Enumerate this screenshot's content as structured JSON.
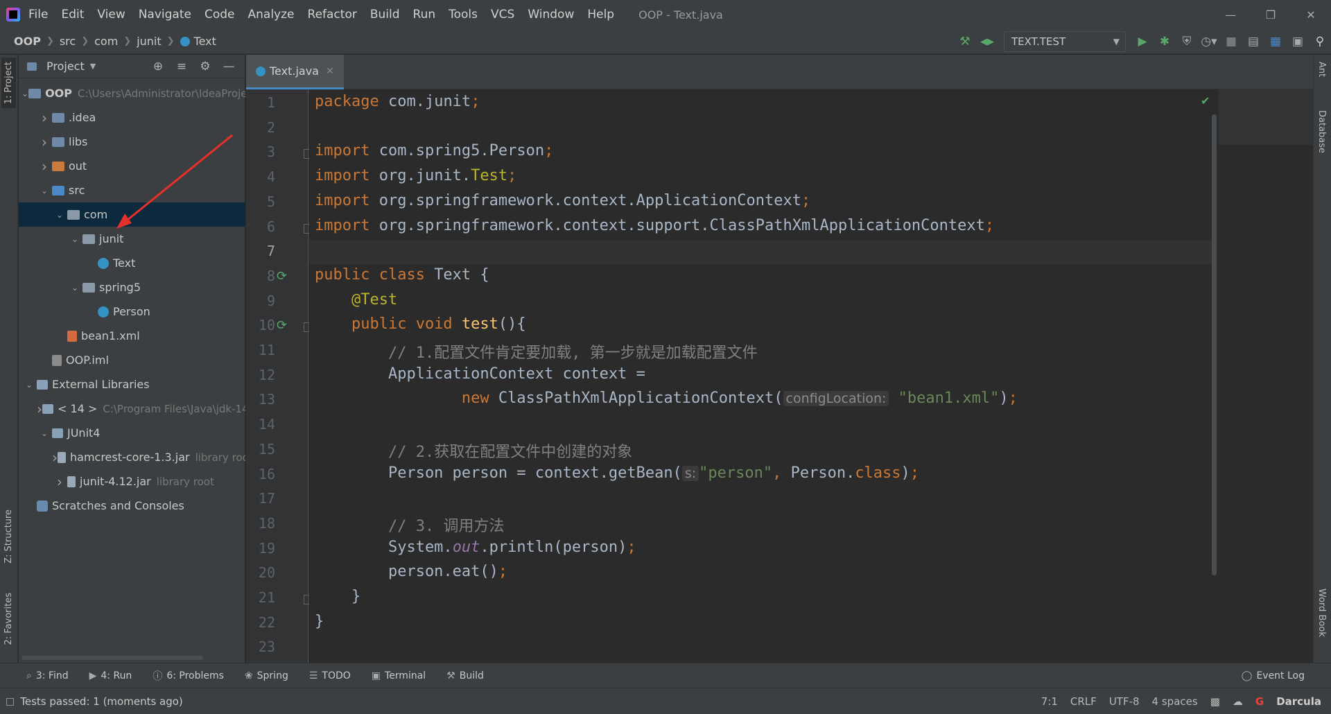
{
  "app": {
    "window_title": "OOP - Text.java",
    "menu": [
      "File",
      "Edit",
      "View",
      "Navigate",
      "Code",
      "Analyze",
      "Refactor",
      "Build",
      "Run",
      "Tools",
      "VCS",
      "Window",
      "Help"
    ]
  },
  "breadcrumbs": [
    "OOP",
    "src",
    "com",
    "junit",
    "Text"
  ],
  "toolbar": {
    "run_config": "TEXT.TEST",
    "icons": [
      "hammer-icon",
      "nav-back-forward-icon",
      "run-icon",
      "debug-icon",
      "coverage-icon",
      "profile-icon",
      "stop-icon",
      "project-structure-icon",
      "translate-icon",
      "terminal-icon",
      "search-icon"
    ]
  },
  "project_panel": {
    "title": "Project",
    "tree": [
      {
        "depth": 0,
        "arrow": "open",
        "icon": "folder",
        "label": "OOP",
        "bold": true,
        "path": "C:\\Users\\Administrator\\IdeaProje"
      },
      {
        "depth": 1,
        "arrow": "closed",
        "icon": "folder",
        "label": ".idea"
      },
      {
        "depth": 1,
        "arrow": "closed",
        "icon": "folder",
        "label": "libs"
      },
      {
        "depth": 1,
        "arrow": "closed",
        "icon": "folder-orange",
        "label": "out"
      },
      {
        "depth": 1,
        "arrow": "open",
        "icon": "folder-blue",
        "label": "src"
      },
      {
        "depth": 2,
        "arrow": "open",
        "icon": "pkg",
        "label": "com",
        "selected": true
      },
      {
        "depth": 3,
        "arrow": "open",
        "icon": "pkg",
        "label": "junit"
      },
      {
        "depth": 4,
        "arrow": "",
        "icon": "cls",
        "label": "Text"
      },
      {
        "depth": 3,
        "arrow": "open",
        "icon": "pkg",
        "label": "spring5"
      },
      {
        "depth": 4,
        "arrow": "",
        "icon": "cls",
        "label": "Person"
      },
      {
        "depth": 2,
        "arrow": "",
        "icon": "xml",
        "label": "bean1.xml"
      },
      {
        "depth": 1,
        "arrow": "",
        "icon": "iml",
        "label": "OOP.iml"
      },
      {
        "depth": 0,
        "arrow": "open",
        "icon": "lib",
        "label": "External Libraries"
      },
      {
        "depth": 1,
        "arrow": "closed",
        "icon": "lib",
        "label": "< 14 >",
        "path": "C:\\Program Files\\Java\\jdk-14"
      },
      {
        "depth": 1,
        "arrow": "open",
        "icon": "lib",
        "label": "JUnit4"
      },
      {
        "depth": 2,
        "arrow": "closed",
        "icon": "jar",
        "label": "hamcrest-core-1.3.jar",
        "path": "library roo"
      },
      {
        "depth": 2,
        "arrow": "closed",
        "icon": "jar",
        "label": "junit-4.12.jar",
        "path": "library root"
      },
      {
        "depth": 0,
        "arrow": "",
        "icon": "scratch",
        "label": "Scratches and Consoles"
      }
    ]
  },
  "editor": {
    "tab": "Text.java",
    "current_line": 7,
    "lines": [
      [
        {
          "t": "package ",
          "c": "kw"
        },
        {
          "t": "com.junit"
        },
        {
          "t": ";",
          "c": "kw"
        }
      ],
      [],
      [
        {
          "t": "import ",
          "c": "kw"
        },
        {
          "t": "com.spring5.Person"
        },
        {
          "t": ";",
          "c": "kw"
        }
      ],
      [
        {
          "t": "import ",
          "c": "kw"
        },
        {
          "t": "org.junit."
        },
        {
          "t": "Test",
          "c": "ann"
        },
        {
          "t": ";",
          "c": "kw"
        }
      ],
      [
        {
          "t": "import ",
          "c": "kw"
        },
        {
          "t": "org.springframework.context.ApplicationContext"
        },
        {
          "t": ";",
          "c": "kw"
        }
      ],
      [
        {
          "t": "import ",
          "c": "kw"
        },
        {
          "t": "org.springframework.context.support.ClassPathXmlApplicationContext"
        },
        {
          "t": ";",
          "c": "kw"
        }
      ],
      [],
      [
        {
          "t": "public class ",
          "c": "kw"
        },
        {
          "t": "Text {"
        }
      ],
      [
        {
          "t": "    "
        },
        {
          "t": "@Test",
          "c": "ann"
        }
      ],
      [
        {
          "t": "    "
        },
        {
          "t": "public void ",
          "c": "kw"
        },
        {
          "t": "test",
          "c": "fn"
        },
        {
          "t": "(){"
        }
      ],
      [
        {
          "t": "        "
        },
        {
          "t": "// 1.配置文件肯定要加载, 第一步就是加载配置文件",
          "c": "cmt"
        }
      ],
      [
        {
          "t": "        ApplicationContext context ="
        }
      ],
      [
        {
          "t": "                "
        },
        {
          "t": "new ",
          "c": "kw"
        },
        {
          "t": "ClassPathXmlApplicationContext("
        },
        {
          "t": "configLocation:",
          "c": "hint"
        },
        {
          "t": " "
        },
        {
          "t": "\"bean1.xml\"",
          "c": "str"
        },
        {
          "t": ")"
        },
        {
          "t": ";",
          "c": "kw"
        }
      ],
      [],
      [
        {
          "t": "        "
        },
        {
          "t": "// 2.获取在配置文件中创建的对象",
          "c": "cmt"
        }
      ],
      [
        {
          "t": "        Person person = context.getBean("
        },
        {
          "t": "s:",
          "c": "hint"
        },
        {
          "t": "\"person\"",
          "c": "str"
        },
        {
          "t": ", ",
          "c": "kw"
        },
        {
          "t": "Person."
        },
        {
          "t": "class",
          "c": "kw"
        },
        {
          "t": ")"
        },
        {
          "t": ";",
          "c": "kw"
        }
      ],
      [],
      [
        {
          "t": "        "
        },
        {
          "t": "// 3. 调用方法",
          "c": "cmt"
        }
      ],
      [
        {
          "t": "        System."
        },
        {
          "t": "out",
          "c": "fld"
        },
        {
          "t": ".println(person)"
        },
        {
          "t": ";",
          "c": "kw"
        }
      ],
      [
        {
          "t": "        person.eat()"
        },
        {
          "t": ";",
          "c": "kw"
        }
      ],
      [
        {
          "t": "    }"
        }
      ],
      [
        {
          "t": "}"
        }
      ],
      []
    ],
    "run_gutter_lines": [
      8,
      10
    ],
    "fold_lines": [
      3,
      6,
      10,
      21
    ]
  },
  "left_stripe": [
    "1: Project",
    "Z: Structure",
    "2: Favorites"
  ],
  "right_stripe": [
    "Ant",
    "Database",
    "Word Book"
  ],
  "bottom_tools": [
    {
      "icon": "search-icon",
      "label": "3: Find"
    },
    {
      "icon": "run-icon",
      "label": "4: Run"
    },
    {
      "icon": "problems-icon",
      "label": "6: Problems"
    },
    {
      "icon": "spring-icon",
      "label": "Spring"
    },
    {
      "icon": "todo-icon",
      "label": "TODO"
    },
    {
      "icon": "terminal-icon",
      "label": "Terminal"
    },
    {
      "icon": "build-icon",
      "label": "Build"
    }
  ],
  "event_log": "Event Log",
  "status": {
    "message": "Tests passed: 1 (moments ago)",
    "position": "7:1",
    "line_sep": "CRLF",
    "encoding": "UTF-8",
    "indent": "4 spaces",
    "theme": "Darcula"
  },
  "colors": {
    "accent": "#4a88c7",
    "selection": "#0d293e",
    "annotation_arrow": "#e8302a"
  }
}
